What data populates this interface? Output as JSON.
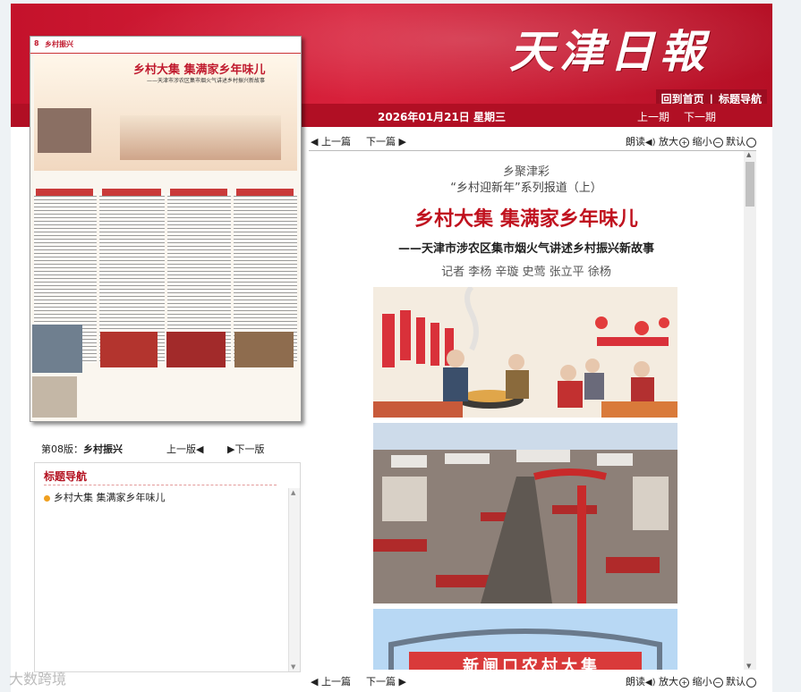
{
  "brand": {
    "logo": "天津日報",
    "brand_red": "#c4122b",
    "accent_red": "#c0121f"
  },
  "top_nav": {
    "home": "回到首页",
    "separator": "|",
    "title_nav": "标题导航"
  },
  "date_bar": {
    "date": "2026年01月21日 星期三",
    "prev_edition": "上一期",
    "next_edition": "下一期"
  },
  "thumbnail": {
    "page_no": "8",
    "section": "乡村振兴",
    "headline": "乡村大集 集满家乡年味儿",
    "subheadline": "——天津市涉农区集市烟火气讲述乡村振兴新故事"
  },
  "edition_nav": {
    "label": "第08版：",
    "section": "乡村振兴",
    "prev": "上一版◀",
    "next": "▶下一版"
  },
  "title_nav_panel": {
    "heading": "标题导航",
    "items": [
      "乡村大集 集满家乡年味儿"
    ]
  },
  "article_toolbar": {
    "prev_article": "◀ 上一篇",
    "next_article": "下一篇 ▶",
    "read": "朗读",
    "zoom_in": "放大",
    "zoom_out": "缩小",
    "default": "默认"
  },
  "article": {
    "column": "乡聚津彩",
    "series": "“乡村迎新年”系列报道（上）",
    "title": "乡村大集  集满家乡年味儿",
    "subtitle": "——天津市涉农区集市烟火气讲述乡村振兴新故事",
    "authors": "记者 李杨 辛璇 史莺 张立平 徐杨",
    "photo3_text": "新闸口农村大集"
  },
  "watermark": "大数跨境"
}
